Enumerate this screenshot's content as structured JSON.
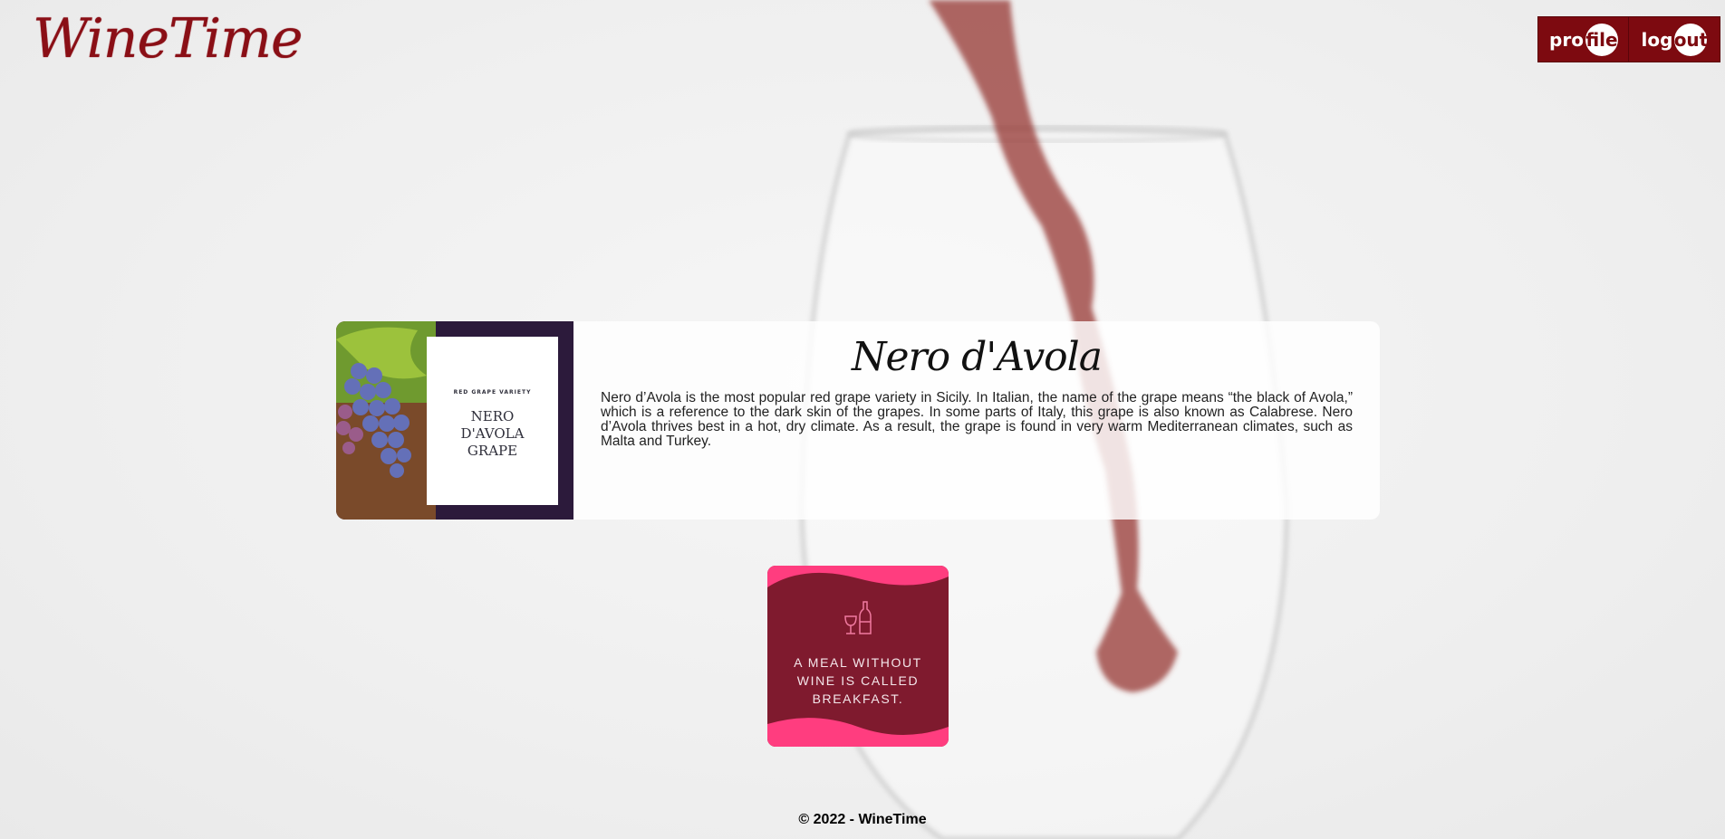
{
  "brand": {
    "logo_text": "WineTime",
    "accent": "#7d0a10"
  },
  "nav": {
    "profile": {
      "prefix": "pro",
      "circle": "file"
    },
    "logout": {
      "prefix": "log",
      "circle": "out"
    }
  },
  "card": {
    "image": {
      "kicker": "RED GRAPE VARIETY",
      "line1": "NERO",
      "line2": "D'AVOLA",
      "line3": "GRAPE"
    },
    "title": "Nero d'Avola",
    "description": "Nero d’Avola is the most popular red grape variety in Sicily. In Italian, the name of the grape means “the black of Avola,” which is a reference to the dark skin of the grapes. In some parts of Italy, this grape is also known as Calabrese. Nero d’Avola thrives best in a hot, dry climate. As a result, the grape is found in very warm Mediterranean climates, such as Malta and Turkey."
  },
  "quote": {
    "line1": "A MEAL WITHOUT",
    "line2": "WINE IS CALLED",
    "line3": "BREAKFAST.",
    "icon": "wine-glass-bottle-icon",
    "colors": {
      "base": "#7f1a2e",
      "wave": "#ff3d7f"
    }
  },
  "footer": {
    "text": "© 2022 - WineTime"
  }
}
